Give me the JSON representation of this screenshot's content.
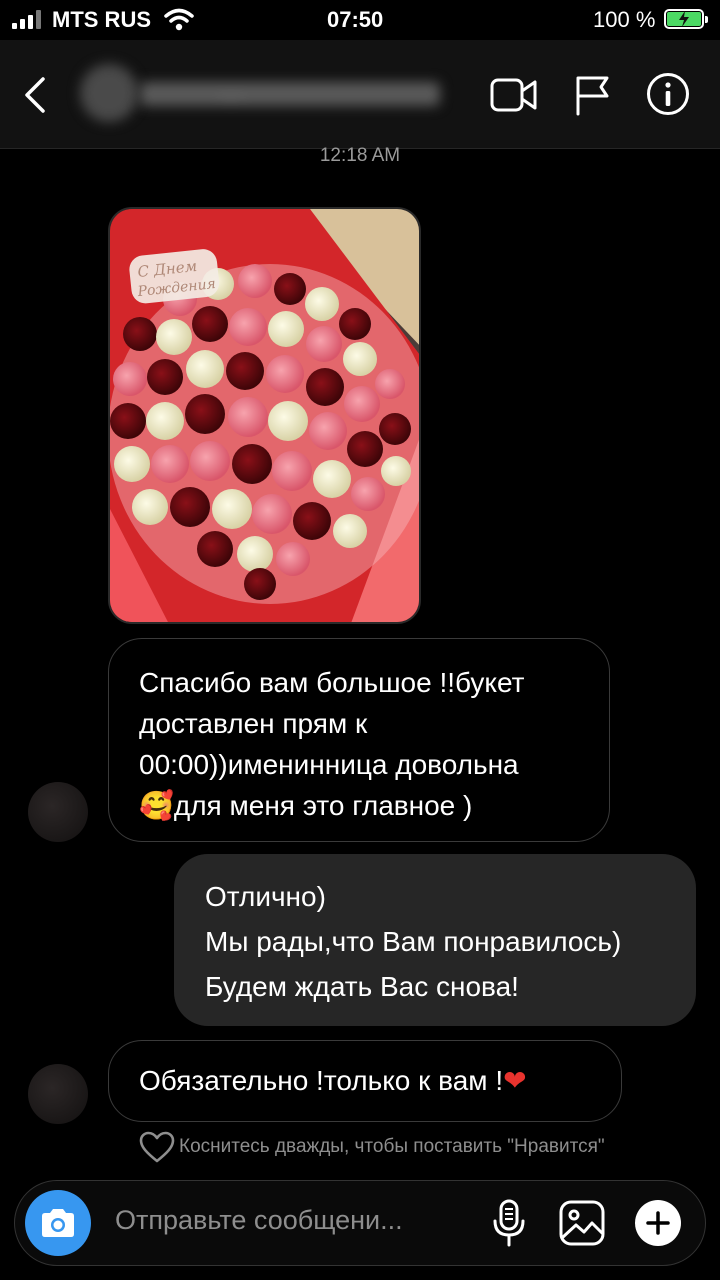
{
  "status": {
    "carrier": "MTS RUS",
    "time": "07:50",
    "battery": "100 %"
  },
  "header": {
    "contact_name": "...",
    "icons": [
      "back-chevron-icon",
      "video-camera-icon",
      "flag-icon",
      "info-icon"
    ]
  },
  "conversation": {
    "timestamp": "12:18 AM",
    "photo_caption": "С Днем Рождения",
    "messages": [
      {
        "direction": "incoming",
        "lines": [
          "Спасибо вам большое !!букет",
          "доставлен прям к",
          "00:00))именинница довольна",
          "для меня это главное )"
        ],
        "emoji": "🥰"
      },
      {
        "direction": "outgoing",
        "lines": [
          "Отлично)",
          "Мы рады,что Вам понравилось)",
          "Будем ждать Вас снова!"
        ]
      },
      {
        "direction": "incoming",
        "text": "Обязательно !только к вам !",
        "emoji": "❤"
      }
    ],
    "like_hint": "Коснитесь дважды, чтобы поставить \"Нравится\""
  },
  "composer": {
    "placeholder": "Отправьте сообщени...",
    "icons": [
      "camera-icon",
      "microphone-icon",
      "gallery-icon",
      "plus-icon"
    ]
  },
  "colors": {
    "accent": "#3797f0",
    "battery": "#4cd964",
    "outgoing_bubble": "#262626"
  }
}
